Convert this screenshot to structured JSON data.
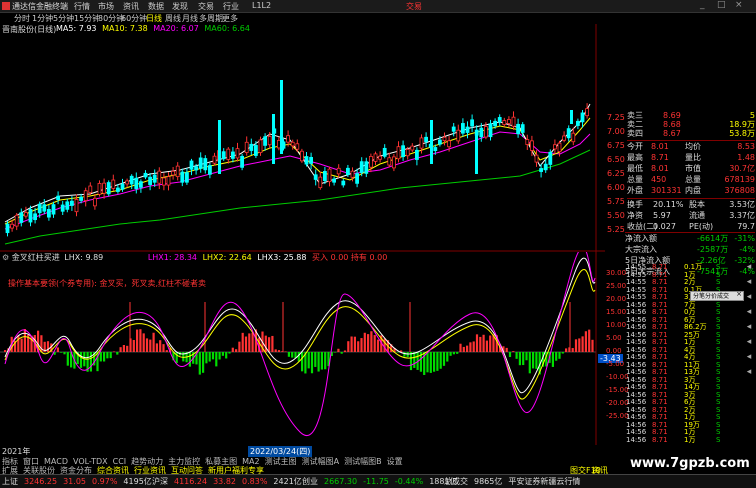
{
  "menubar": {
    "app_title": "通达信金融终端",
    "items": [
      "行情",
      "市场",
      "资讯",
      "数据",
      "发现",
      "交易",
      "行业",
      "L1L2"
    ],
    "trade_label": "交易",
    "window_controls": [
      "_",
      "□",
      "×"
    ]
  },
  "periods": [
    "分时",
    "1分钟",
    "5分钟",
    "15分钟",
    "30分钟",
    "60分钟",
    "日线",
    "周线",
    "月线",
    "多周期",
    "更多"
  ],
  "active_period": "日线",
  "kchart": {
    "stock_label": "晋南股份(日线)",
    "ma_legend": [
      {
        "text": "MA5: 7.93",
        "color": "#ffffff"
      },
      {
        "text": "MA10: 7.38",
        "color": "#ffff00"
      },
      {
        "text": "MA20: 6.07",
        "color": "#ff00ff"
      },
      {
        "text": "MA60: 6.64",
        "color": "#00dd00"
      }
    ],
    "price_ticks": [
      "7.25",
      "7.00",
      "6.75",
      "6.50",
      "6.25",
      "6.00",
      "5.75",
      "5.50",
      "5.25"
    ],
    "colors": {
      "up": "#ff3333",
      "down": "#00ffff",
      "ma5": "#ffffff",
      "ma10": "#ffff00",
      "ma20": "#ff00ff",
      "ma60": "#00cc00",
      "grid": "#800000"
    }
  },
  "indicator": {
    "name": "金叉红柱买进",
    "lhx": "LHX: 9.89",
    "lhx1": "LHX1: 28.34",
    "lhx2": "LHX2: 22.64",
    "lhx3": "LHX3: 25.88",
    "note": "操作基本要领(个券专用): 金叉买，死叉卖,红柱不碰者卖",
    "signal_buy": "买入",
    "signal_extra": "0.00 持有 0.00",
    "ticks": [
      "30.00",
      "25.00",
      "20.00",
      "15.00",
      "10.00",
      "5.00",
      "0.00",
      "-5.00",
      "-10.00",
      "-15.00",
      "-20.00",
      "-25.00"
    ],
    "value_marker": "-3.43"
  },
  "x_axis": {
    "left_label": "2021年",
    "cursor_date": "2022/03/24(四)"
  },
  "quote": {
    "asks": [
      [
        "卖三",
        "8.69",
        "5"
      ],
      [
        "卖二",
        "8.68",
        "18.9万"
      ],
      [
        "卖四",
        "8.67",
        "53.8万"
      ]
    ],
    "stats": [
      [
        "今开",
        "8.01",
        "均价",
        "8.53"
      ],
      [
        "最高",
        "8.71",
        "量比",
        "1.48"
      ],
      [
        "最低",
        "8.01",
        "市值",
        "30.7亿"
      ],
      [
        "总量",
        "450",
        "总量",
        "678139"
      ],
      [
        "外盘",
        "301331",
        "内盘",
        "376808"
      ]
    ],
    "stats2": [
      [
        "换手",
        "20.11%",
        "股本",
        "3.53亿"
      ],
      [
        "净资",
        "5.97",
        "流通",
        "3.37亿"
      ],
      [
        "收益(二)",
        "0.027",
        "PE(动)",
        "79.7"
      ]
    ],
    "flows": [
      [
        "净流入额",
        "-6614万",
        "-31%"
      ],
      [
        "大宗流入",
        "-2587万",
        "-4%"
      ],
      [
        "5日净流入额",
        "-2.26亿",
        "-32%"
      ],
      [
        "5日大宗流入",
        "-7541万",
        "-4%"
      ]
    ]
  },
  "ticks_list": [
    [
      "14:55",
      "8.71",
      "0.1万",
      "S"
    ],
    [
      "14:55",
      "8.71",
      "1万",
      "S"
    ],
    [
      "14:55",
      "8.71",
      "2万",
      "S"
    ],
    [
      "14:55",
      "8.71",
      "0.1万",
      "S"
    ],
    [
      "14:55",
      "8.71",
      "3万",
      "S"
    ],
    [
      "14:56",
      "8.71",
      "7万",
      "S"
    ],
    [
      "14:56",
      "8.71",
      "0万",
      "S"
    ],
    [
      "14:56",
      "8.71",
      "6万",
      "S"
    ],
    [
      "14:56",
      "8.71",
      "86.2万",
      "S"
    ],
    [
      "14:56",
      "8.71",
      "25万",
      "S"
    ],
    [
      "14:56",
      "8.71",
      "1万",
      "S"
    ],
    [
      "14:56",
      "8.71",
      "4万",
      "S"
    ],
    [
      "14:56",
      "8.71",
      "4万",
      "S"
    ],
    [
      "14:56",
      "8.71",
      "11万",
      "S"
    ],
    [
      "14:56",
      "8.71",
      "13万",
      "S"
    ],
    [
      "14:56",
      "8.71",
      "3万",
      "S"
    ],
    [
      "14:56",
      "8.71",
      "14万",
      "S"
    ],
    [
      "14:56",
      "8.71",
      "3万",
      "S"
    ],
    [
      "14:56",
      "8.71",
      "6万",
      "S"
    ],
    [
      "14:56",
      "8.71",
      "2万",
      "S"
    ],
    [
      "14:56",
      "8.71",
      "1万",
      "S"
    ],
    [
      "14:56",
      "8.71",
      "19万",
      "S"
    ],
    [
      "14:56",
      "8.71",
      "1万",
      "S"
    ],
    [
      "14:56",
      "8.71",
      "1万",
      "S"
    ]
  ],
  "popup": {
    "title": "分笔分价成交",
    "close": "×"
  },
  "tabs1": [
    "指标",
    "窗口",
    "MACD",
    "VOL-TDX",
    "CCI",
    "趋势动力",
    "主力监控",
    "私募主图",
    "MA2",
    "测试主图",
    "测试幅图A",
    "测试幅图B",
    "设置"
  ],
  "tabs2": [
    "扩展",
    "关联股份",
    "资金分布",
    "综合资讯",
    "行业资讯",
    "互动问答",
    "新用户福利专享"
  ],
  "bottom_right": [
    "图交F10",
    "资讯"
  ],
  "status": [
    {
      "label": "上证",
      "value": "3246.25",
      "chg": "31.05",
      "pct": "0.97%",
      "amt": "4195亿",
      "cls": "red"
    },
    {
      "label": "沪深",
      "value": "4116.24",
      "chg": "33.82",
      "pct": "0.83%",
      "amt": "2421亿",
      "cls": "red"
    },
    {
      "label": "创业",
      "value": "2667.30",
      "chg": "-11.75",
      "pct": "-0.44%",
      "amt": "1881亿",
      "cls": "grn"
    }
  ],
  "status_extra": [
    "总成交",
    "9865亿",
    "平安证券新疆云行情"
  ],
  "watermark": "www.7gpzb.com"
}
